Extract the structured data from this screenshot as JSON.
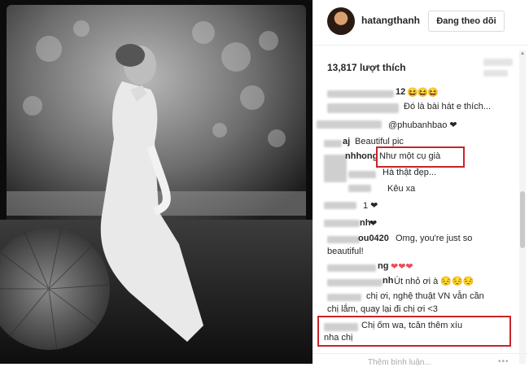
{
  "post": {
    "username": "hatangthanh",
    "follow_label": "Đang theo dõi",
    "likes": "13,817 lượt thích"
  },
  "comments": [
    {
      "user_tail": "12",
      "text": "😆😆😆",
      "text2": "Đó là bài hát e thích..."
    },
    {
      "text": "@phubanhbao ❤"
    },
    {
      "user_tail": "aj",
      "text": "Beautiful pic"
    },
    {
      "user_tail": "nhhong",
      "text": "Như một cụ già"
    },
    {
      "text": "Hà thật đẹp..."
    },
    {
      "text": "Kêu xa"
    },
    {
      "text": "1 ❤"
    },
    {
      "user_tail": "nh",
      "text": "❤"
    },
    {
      "user_tail": "ou0420",
      "text": "Omg, you're just so",
      "text2": "beautiful!"
    },
    {
      "user_tail": "ng",
      "text": "❤❤❤"
    },
    {
      "user_tail": "nh",
      "text": "Út nhỏ ơi à 😔😔😔"
    },
    {
      "text": "chị ơi, nghệ thuật VN vẫn cần",
      "text2": "chị lắm, quay lại đi chị ơi <3"
    },
    {
      "text": "Chị ốm wa, tcăn thêm xíu",
      "text2": "nha chị"
    }
  ],
  "footer": {
    "add_comment": "Thêm bình luận...",
    "more": "•••"
  },
  "colors": {
    "highlight": "#c8242a",
    "heart": "#ed4956"
  }
}
